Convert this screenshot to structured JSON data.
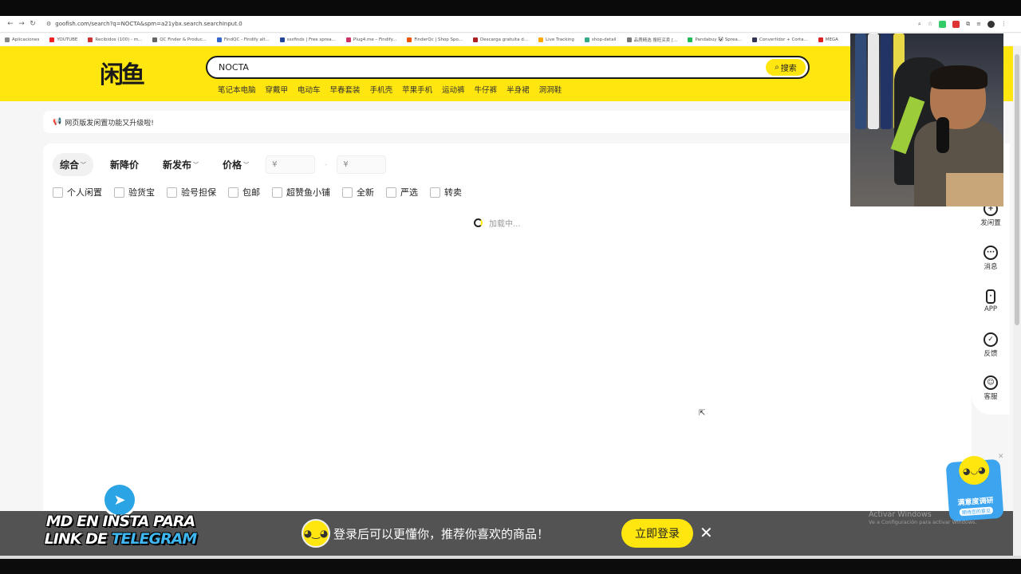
{
  "browser": {
    "url": "goofish.com/search?q=NOCTA&spm=a21ybx.search.searchInput.0",
    "bookmarks": [
      {
        "label": "Aplicaciones",
        "color": "#888"
      },
      {
        "label": "YOUTUBE",
        "color": "#e22"
      },
      {
        "label": "Recibidos (100) - m...",
        "color": "#c33"
      },
      {
        "label": "QC Finder & Produc...",
        "color": "#666"
      },
      {
        "label": "FindQC - Findify alt...",
        "color": "#36c"
      },
      {
        "label": "sssfinds | Free sprea...",
        "color": "#249"
      },
      {
        "label": "Plug4.me – Findify...",
        "color": "#c36"
      },
      {
        "label": "FinderQc | Shop Spo...",
        "color": "#e50"
      },
      {
        "label": "Descarga gratuita d...",
        "color": "#a22"
      },
      {
        "label": "Live Tracking",
        "color": "#fa0"
      },
      {
        "label": "shop-detail",
        "color": "#3a8"
      },
      {
        "label": "品质精选 搜旺买卖 [...",
        "color": "#777"
      },
      {
        "label": "Pandabuy 🐼 Sprea...",
        "color": "#2b5"
      },
      {
        "label": "Convertidor + Corta...",
        "color": "#335"
      },
      {
        "label": "MEGA",
        "color": "#d22"
      }
    ]
  },
  "header": {
    "logo_text": "闲鱼",
    "search_value": "NOCTA",
    "search_button": "搜索",
    "hot_tags": [
      "笔记本电脑",
      "穿戴甲",
      "电动车",
      "早春套装",
      "手机壳",
      "苹果手机",
      "运动裤",
      "牛仔裤",
      "半身裙",
      "洞洞鞋"
    ]
  },
  "notice": {
    "text": "网页版发闲置功能又升级啦!"
  },
  "sort": {
    "items": [
      {
        "label": "综合",
        "chevron": true,
        "active": true
      },
      {
        "label": "新降价",
        "chevron": false,
        "active": false
      },
      {
        "label": "新发布",
        "chevron": true,
        "active": false
      },
      {
        "label": "价格",
        "chevron": true,
        "active": false
      }
    ],
    "price_min_placeholder": "¥",
    "price_max_placeholder": "¥",
    "dash": "-"
  },
  "filters": [
    "个人闲置",
    "验货宝",
    "验号担保",
    "包邮",
    "超赞鱼小铺",
    "全新",
    "严选",
    "转卖"
  ],
  "loading_text": "加载中...",
  "sidebar": [
    {
      "label": "发闲置",
      "icon": "plus-circle-icon",
      "glyph": "+"
    },
    {
      "label": "消息",
      "icon": "message-icon",
      "glyph": "···"
    },
    {
      "label": "APP",
      "icon": "phone-icon",
      "glyph": "·"
    },
    {
      "label": "反馈",
      "icon": "feedback-icon",
      "glyph": "✓"
    },
    {
      "label": "客服",
      "icon": "customer-service-icon",
      "glyph": "☺"
    }
  ],
  "overlay": {
    "promo_line1": "MD EN INSTA PARA",
    "promo_line2a": "LINK DE ",
    "promo_line2b": "TELEGRAM",
    "login_prompt": "登录后可以更懂你，推荐你喜欢的商品！",
    "login_button": "立即登录",
    "survey_title": "满意度调研",
    "survey_sub": "期待您的意见",
    "activate_title": "Activar Windows",
    "activate_sub": "Ve a Configuración para activar Windows."
  }
}
